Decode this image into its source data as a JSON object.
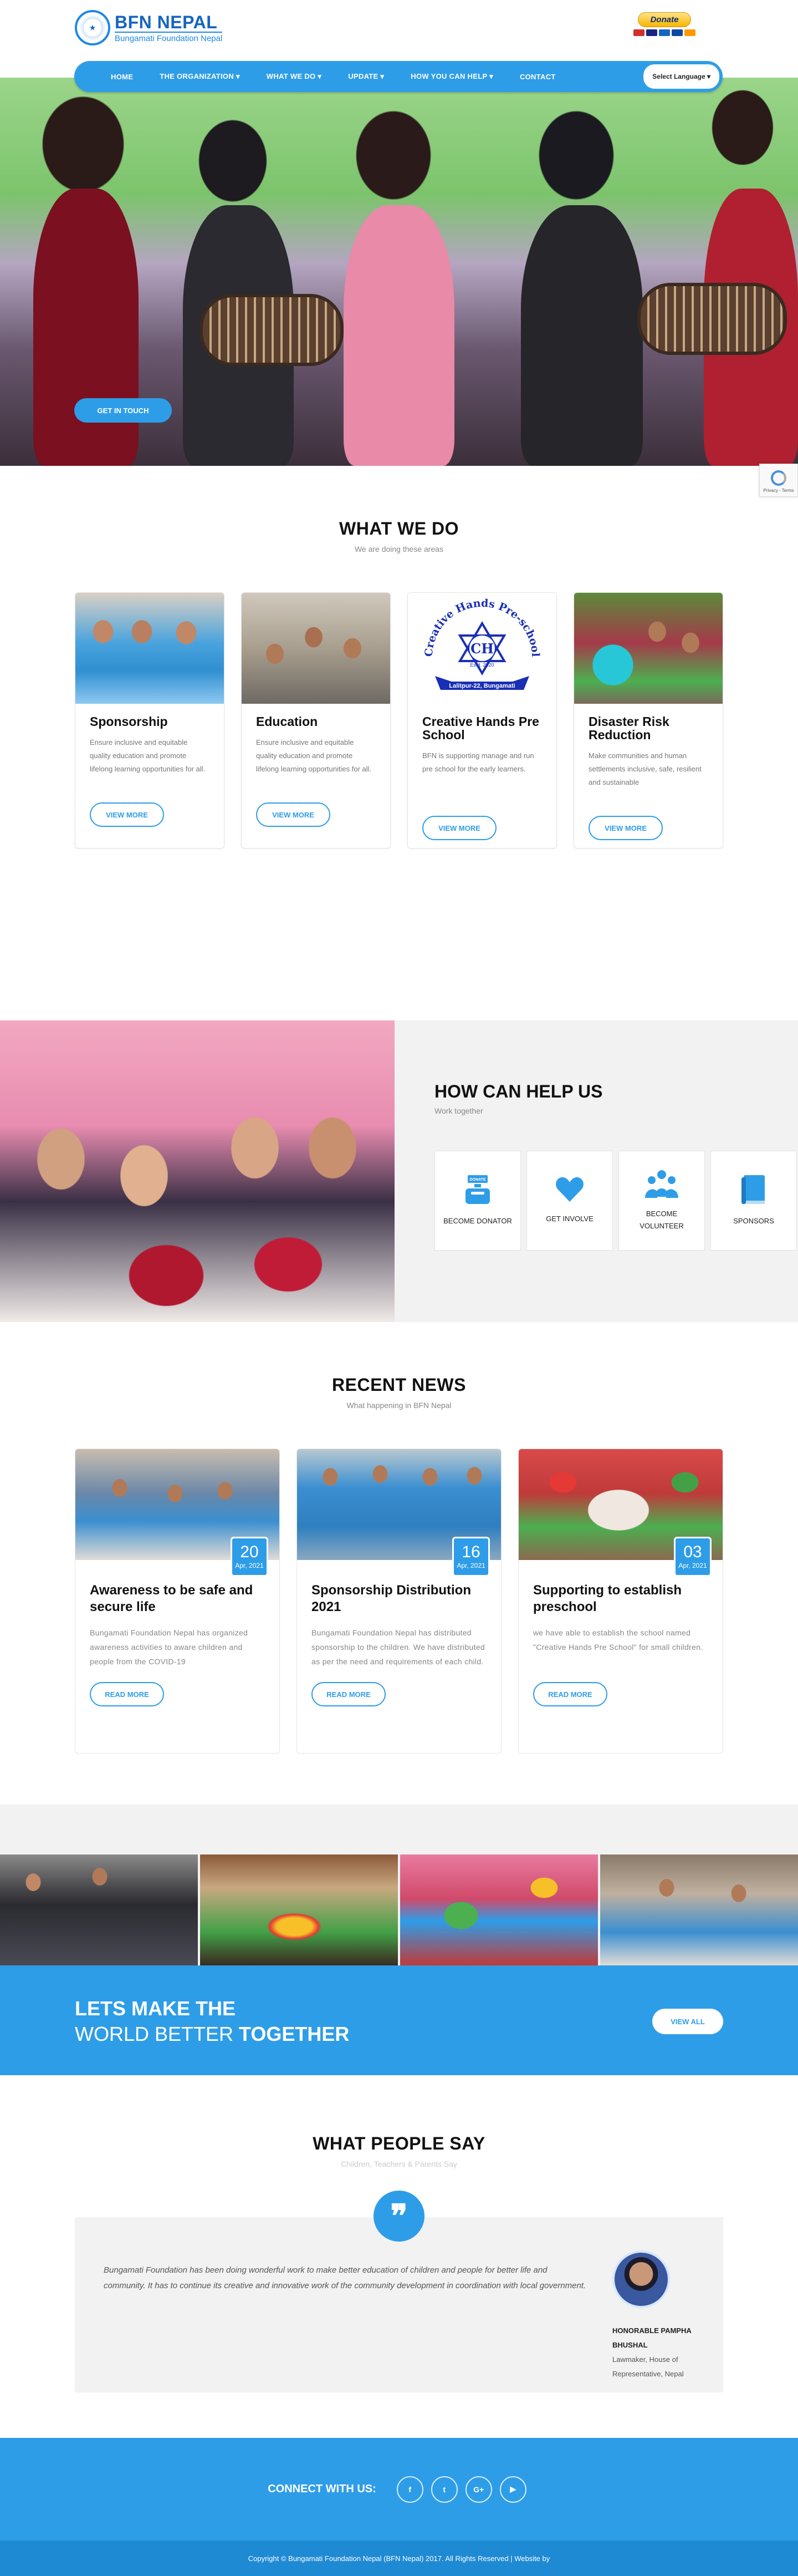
{
  "header": {
    "logo_title": "BFN NEPAL",
    "logo_sub": "Bungamati Foundation Nepal",
    "donate_label": "Donate"
  },
  "nav": {
    "items": [
      {
        "label": "Home"
      },
      {
        "label": "The Organization ▾"
      },
      {
        "label": "What We Do ▾"
      },
      {
        "label": "Update ▾"
      },
      {
        "label": "How You Can Help ▾"
      },
      {
        "label": "Contact"
      }
    ],
    "language_label": "Select Language ▾"
  },
  "hero": {
    "cta_label": "Get In Touch"
  },
  "recaptcha": {
    "label": "Privacy - Terms"
  },
  "what_we_do": {
    "title": "WHAT WE DO",
    "subtitle": "We are doing these areas",
    "cards": [
      {
        "title": "Sponsorship",
        "desc": "Ensure inclusive and equitable quality education and promote lifelong learning opportunities for all.",
        "button": "View More"
      },
      {
        "title": "Education",
        "desc": "Ensure inclusive and equitable quality education and promote lifelong learning opportunities for all.",
        "button": "View More"
      },
      {
        "title": "Creative Hands Pre School",
        "desc": "BFN is supporting manage and run pre school for the early learners.",
        "button": "View More"
      },
      {
        "title": "Disaster Risk Reduction",
        "desc": "Make communities and human settlements inclusive, safe, resilient and sustainable",
        "button": "View More"
      }
    ],
    "school_logo": {
      "top": "Creative Hands Pre-school",
      "mid": "CH",
      "estd": "Estd. 2020",
      "bottom": "Lalitpur-22, Bungamati"
    }
  },
  "help": {
    "title": "HOW CAN HELP US",
    "subtitle": "Work together",
    "boxes": [
      {
        "label": "Become Donator",
        "icon": "donate-icon"
      },
      {
        "label": "Get Involve",
        "icon": "heart-icon"
      },
      {
        "label": "Become Volunteer",
        "icon": "group-icon"
      },
      {
        "label": "Sponsors",
        "icon": "book-icon"
      }
    ]
  },
  "news": {
    "title": "RECENT NEWS",
    "subtitle": "What happening in BFN Nepal",
    "items": [
      {
        "title": "Awareness to be safe and secure life",
        "desc": "Bungamati Foundation Nepal has organized awareness activities to aware children and people from the COVID-19",
        "day": "20",
        "month": "Apr, 2021",
        "button": "Read More"
      },
      {
        "title": "Sponsorship Distribution 2021",
        "desc": "Bungamati Foundation Nepal has distributed sponsorship to the children. We have distributed as per the need and requirements of each child.",
        "day": "16",
        "month": "Apr, 2021",
        "button": "Read More"
      },
      {
        "title": "Supporting to establish preschool",
        "desc": "we have able to establish the school named \"Creative Hands Pre School\" for small children.",
        "day": "03",
        "month": "Apr, 2021",
        "button": "Read More"
      }
    ]
  },
  "banner": {
    "line1": "LETS MAKE THE",
    "line2_pre": "WORLD BETTER ",
    "line2_bold": "TOGETHER",
    "button": "View All"
  },
  "testimonial": {
    "title": "WHAT PEOPLE SAY",
    "subtitle": "Children, Teachers & Parents Say",
    "quote_mark": "❞",
    "text": "Bungamati Foundation has been doing wonderful work to make better education of children and people for better life and community. It has to continue its creative and innovative work of the community development in coordination with local government.",
    "author_name": "HONORABLE PAMPHA BHUSHAL",
    "author_role": "Lawmaker, House of Representative, Nepal"
  },
  "footer": {
    "connect": "CONNECT WITH US:",
    "social": [
      {
        "glyph": "f",
        "icon": "facebook-icon"
      },
      {
        "glyph": "t",
        "icon": "twitter-icon"
      },
      {
        "glyph": "G+",
        "icon": "google-plus-icon"
      },
      {
        "glyph": "▶",
        "icon": "youtube-icon"
      }
    ],
    "copyright": "Copyright © Bungamati Foundation Nepal (BFN Nepal) 2017. All Rights Reserved | Website by"
  },
  "colors": {
    "accent": "#2e9de8",
    "dark_accent": "#1565c0",
    "light_bg": "#f2f2f2"
  }
}
